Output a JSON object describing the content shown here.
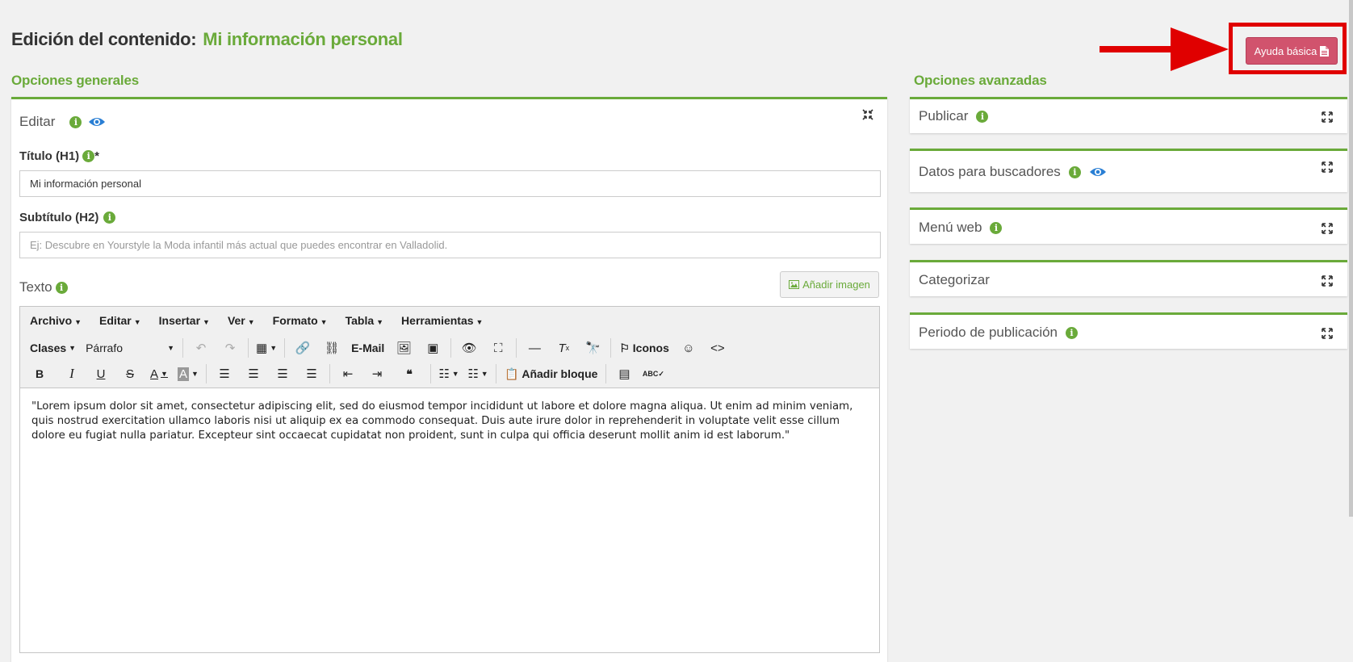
{
  "header": {
    "title": "Edición del contenido:",
    "content_name": "Mi información personal",
    "help_button": "Ayuda básica"
  },
  "general": {
    "section_title": "Opciones generales",
    "panel_label": "Editar",
    "title_label": "Título (H1)",
    "title_required": "*",
    "title_value": "Mi información personal",
    "subtitle_label": "Subtítulo (H2)",
    "subtitle_placeholder": "Ej: Descubre en Yourstyle la Moda infantil más actual que puedes encontrar en Valladolid.",
    "text_label": "Texto",
    "add_image": "Añadir imagen"
  },
  "editor": {
    "menu": [
      "Archivo",
      "Editar",
      "Insertar",
      "Ver",
      "Formato",
      "Tabla",
      "Herramientas"
    ],
    "classes": "Clases",
    "paragraph": "Párrafo",
    "email": "E-Mail",
    "icons": "Iconos",
    "add_block": "Añadir bloque",
    "content": "\"Lorem ipsum dolor sit amet, consectetur adipiscing elit, sed do eiusmod tempor incididunt ut labore et dolore magna aliqua. Ut enim ad minim veniam, quis nostrud exercitation ullamco laboris nisi ut aliquip ex ea commodo consequat. Duis aute irure dolor in reprehenderit in voluptate velit esse cillum dolore eu fugiat nulla pariatur. Excepteur sint occaecat cupidatat non proident, sunt in culpa qui officia deserunt mollit anim id est laborum.\""
  },
  "advanced": {
    "section_title": "Opciones avanzadas",
    "panels": [
      "Publicar",
      "Datos para buscadores",
      "Menú web",
      "Categorizar",
      "Periodo de publicación"
    ]
  },
  "colors": {
    "accent_green": "#6aaa3a",
    "help_button": "#d1536d",
    "annotation_red": "#e00000"
  }
}
